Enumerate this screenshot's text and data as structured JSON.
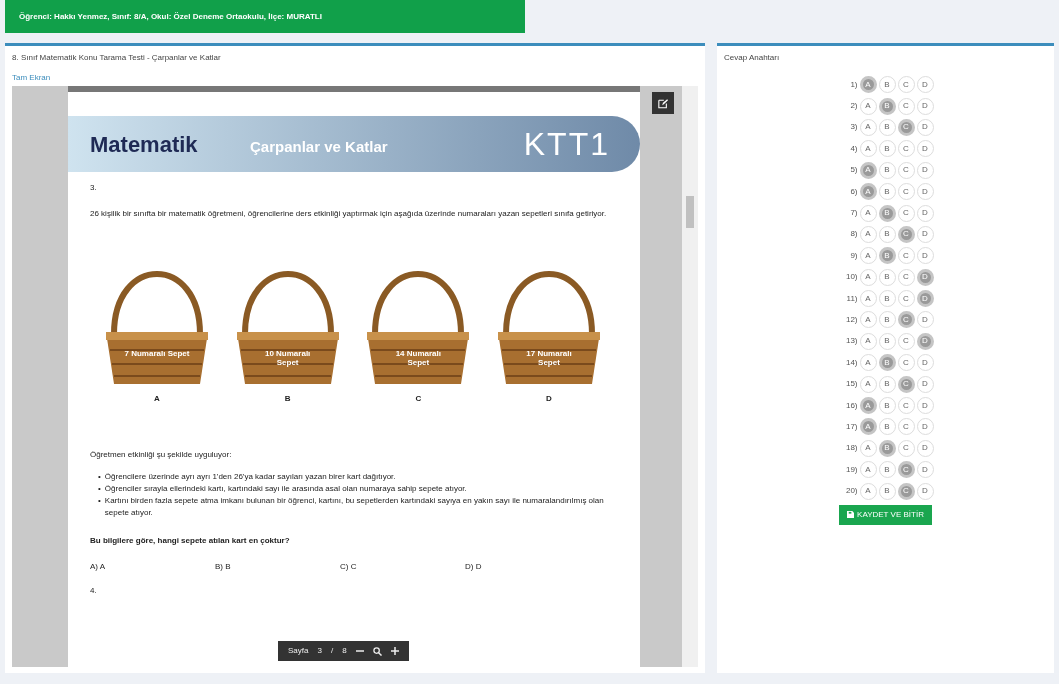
{
  "student_bar": {
    "text": "Öğrenci: Hakkı Yenmez, Sınıf: 8/A, Okul: Özel Deneme Ortaokulu, İlçe: MURATLI"
  },
  "test_panel": {
    "title": "8. Sınıf Matematik Konu Tarama Testi - Çarpanlar ve Katlar",
    "fullscreen_link": "Tam Ekran",
    "document": {
      "banner_subject": "Matematik",
      "banner_topic": "Çarpanlar ve Katlar",
      "banner_code": "KTT1",
      "question_number": "3.",
      "intro": "26 kişilik bir sınıfta bir matematik öğretmeni, öğrencilerine ders etkinliği yaptırmak için aşağıda üzerinde numaraları yazan sepetleri sınıfa getiriyor.",
      "baskets": [
        {
          "label": "7 Numaralı Sepet",
          "letter": "A"
        },
        {
          "label": "10 Numaralı Sepet",
          "letter": "B"
        },
        {
          "label": "14 Numaralı Sepet",
          "letter": "C"
        },
        {
          "label": "17 Numaralı Sepet",
          "letter": "D"
        }
      ],
      "activity_intro": "Öğretmen etkinliği şu şekilde uyguluyor:",
      "bullets": [
        {
          "marker": "•",
          "text": "Öğrencilere üzerinde ayrı ayrı 1'den 26'ya kadar sayıları yazan birer kart dağıtıyor."
        },
        {
          "marker": "•",
          "text": "Öğrenciler sırayla ellerindeki kartı, kartındaki sayı ile arasında asal olan numaraya sahip sepete atıyor."
        },
        {
          "marker": "•",
          "text": "Kartını birden fazla sepete atma imkanı bulunan bir öğrenci, kartını, bu sepetlerden kartındaki sayıya en yakın sayı ile numaralandırılmış olan sepete atıyor."
        }
      ],
      "question": "Bu bilgilere göre, hangi sepete atılan kart en çoktur?",
      "options": [
        "A) A",
        "B) B",
        "C) C",
        "D) D"
      ],
      "next_question_number": "4."
    },
    "page_toolbar": {
      "label": "Sayfa",
      "page": "3",
      "separator": "/",
      "total": "8"
    }
  },
  "answer_panel": {
    "title": "Cevap Anahtarı",
    "rows": [
      {
        "number": "1)",
        "choices": [
          {
            "letter": "A",
            "selected": true
          },
          {
            "letter": "B",
            "selected": false
          },
          {
            "letter": "C",
            "selected": false
          },
          {
            "letter": "D",
            "selected": false
          }
        ]
      },
      {
        "number": "2)",
        "choices": [
          {
            "letter": "A",
            "selected": false
          },
          {
            "letter": "B",
            "selected": true
          },
          {
            "letter": "C",
            "selected": false
          },
          {
            "letter": "D",
            "selected": false
          }
        ]
      },
      {
        "number": "3)",
        "choices": [
          {
            "letter": "A",
            "selected": false
          },
          {
            "letter": "B",
            "selected": false
          },
          {
            "letter": "C",
            "selected": true
          },
          {
            "letter": "D",
            "selected": false
          }
        ]
      },
      {
        "number": "4)",
        "choices": [
          {
            "letter": "A",
            "selected": false
          },
          {
            "letter": "B",
            "selected": false
          },
          {
            "letter": "C",
            "selected": false
          },
          {
            "letter": "D",
            "selected": false
          }
        ]
      },
      {
        "number": "5)",
        "choices": [
          {
            "letter": "A",
            "selected": true
          },
          {
            "letter": "B",
            "selected": false
          },
          {
            "letter": "C",
            "selected": false
          },
          {
            "letter": "D",
            "selected": false
          }
        ]
      },
      {
        "number": "6)",
        "choices": [
          {
            "letter": "A",
            "selected": true
          },
          {
            "letter": "B",
            "selected": false
          },
          {
            "letter": "C",
            "selected": false
          },
          {
            "letter": "D",
            "selected": false
          }
        ]
      },
      {
        "number": "7)",
        "choices": [
          {
            "letter": "A",
            "selected": false
          },
          {
            "letter": "B",
            "selected": true
          },
          {
            "letter": "C",
            "selected": false
          },
          {
            "letter": "D",
            "selected": false
          }
        ]
      },
      {
        "number": "8)",
        "choices": [
          {
            "letter": "A",
            "selected": false
          },
          {
            "letter": "B",
            "selected": false
          },
          {
            "letter": "C",
            "selected": true
          },
          {
            "letter": "D",
            "selected": false
          }
        ]
      },
      {
        "number": "9)",
        "choices": [
          {
            "letter": "A",
            "selected": false
          },
          {
            "letter": "B",
            "selected": true
          },
          {
            "letter": "C",
            "selected": false
          },
          {
            "letter": "D",
            "selected": false
          }
        ]
      },
      {
        "number": "10)",
        "choices": [
          {
            "letter": "A",
            "selected": false
          },
          {
            "letter": "B",
            "selected": false
          },
          {
            "letter": "C",
            "selected": false
          },
          {
            "letter": "D",
            "selected": true
          }
        ]
      },
      {
        "number": "11)",
        "choices": [
          {
            "letter": "A",
            "selected": false
          },
          {
            "letter": "B",
            "selected": false
          },
          {
            "letter": "C",
            "selected": false
          },
          {
            "letter": "D",
            "selected": true
          }
        ]
      },
      {
        "number": "12)",
        "choices": [
          {
            "letter": "A",
            "selected": false
          },
          {
            "letter": "B",
            "selected": false
          },
          {
            "letter": "C",
            "selected": true
          },
          {
            "letter": "D",
            "selected": false
          }
        ]
      },
      {
        "number": "13)",
        "choices": [
          {
            "letter": "A",
            "selected": false
          },
          {
            "letter": "B",
            "selected": false
          },
          {
            "letter": "C",
            "selected": false
          },
          {
            "letter": "D",
            "selected": true
          }
        ]
      },
      {
        "number": "14)",
        "choices": [
          {
            "letter": "A",
            "selected": false
          },
          {
            "letter": "B",
            "selected": true
          },
          {
            "letter": "C",
            "selected": false
          },
          {
            "letter": "D",
            "selected": false
          }
        ]
      },
      {
        "number": "15)",
        "choices": [
          {
            "letter": "A",
            "selected": false
          },
          {
            "letter": "B",
            "selected": false
          },
          {
            "letter": "C",
            "selected": true
          },
          {
            "letter": "D",
            "selected": false
          }
        ]
      },
      {
        "number": "16)",
        "choices": [
          {
            "letter": "A",
            "selected": true
          },
          {
            "letter": "B",
            "selected": false
          },
          {
            "letter": "C",
            "selected": false
          },
          {
            "letter": "D",
            "selected": false
          }
        ]
      },
      {
        "number": "17)",
        "choices": [
          {
            "letter": "A",
            "selected": true
          },
          {
            "letter": "B",
            "selected": false
          },
          {
            "letter": "C",
            "selected": false
          },
          {
            "letter": "D",
            "selected": false
          }
        ]
      },
      {
        "number": "18)",
        "choices": [
          {
            "letter": "A",
            "selected": false
          },
          {
            "letter": "B",
            "selected": true
          },
          {
            "letter": "C",
            "selected": false
          },
          {
            "letter": "D",
            "selected": false
          }
        ]
      },
      {
        "number": "19)",
        "choices": [
          {
            "letter": "A",
            "selected": false
          },
          {
            "letter": "B",
            "selected": false
          },
          {
            "letter": "C",
            "selected": true
          },
          {
            "letter": "D",
            "selected": false
          }
        ]
      },
      {
        "number": "20)",
        "choices": [
          {
            "letter": "A",
            "selected": false
          },
          {
            "letter": "B",
            "selected": false
          },
          {
            "letter": "C",
            "selected": true
          },
          {
            "letter": "D",
            "selected": false
          }
        ]
      }
    ],
    "save_button": "KAYDET VE BİTİR"
  }
}
